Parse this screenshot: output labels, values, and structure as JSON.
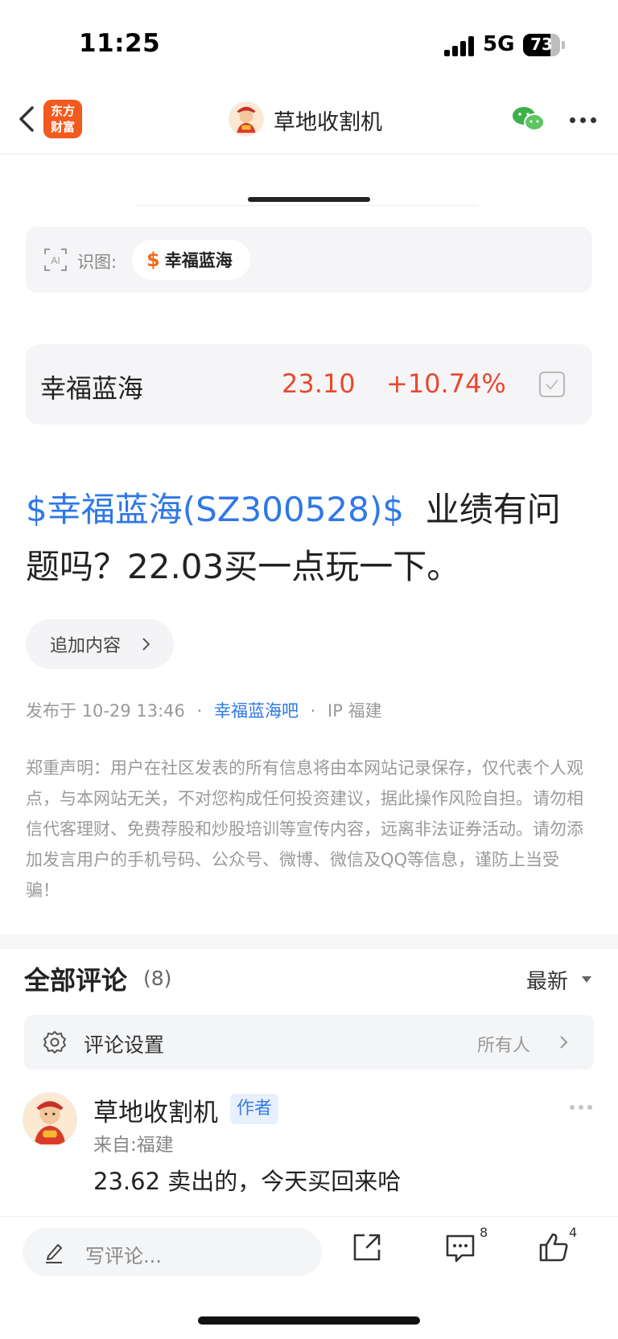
{
  "status_bar": {
    "time": "11:25",
    "network": "5G",
    "battery": "73",
    "battery_level_pct": 73
  },
  "nav": {
    "title": "草地收割机",
    "app_logo_line1": "东方",
    "app_logo_line2": "财富"
  },
  "ai_recognition": {
    "label": "识图:",
    "chip_symbol": "$",
    "chip_name": "幸福蓝海"
  },
  "quote": {
    "name": "幸福蓝海",
    "price": "23.10",
    "change": "+10.74%"
  },
  "post": {
    "stock_link": "$幸福蓝海(SZ300528)$",
    "text_part1": "业绩有问",
    "text_part2": "题吗？22.03买一点玩一下。",
    "add_content_label": "追加内容",
    "published_prefix": "发布于",
    "published_time": "10-29 13:46",
    "bar_name": "幸福蓝海吧",
    "ip_label": "IP 福建",
    "separator": "·"
  },
  "disclaimer": "郑重声明：用户在社区发表的所有信息将由本网站记录保存，仅代表个人观点，与本网站无关，不对您构成任何投资建议，据此操作风险自担。请勿相信代客理财、免费荐股和炒股培训等宣传内容，远离非法证券活动。请勿添加发言用户的手机号码、公众号、微博、微信及QQ等信息，谨防上当受骗！",
  "comments": {
    "title": "全部评论",
    "count": "(8)",
    "sort": "最新",
    "settings_label": "评论设置",
    "settings_value": "所有人",
    "items": [
      {
        "author": "草地收割机",
        "badge": "作者",
        "location": "来自:福建",
        "text": "23.62 卖出的，今天买回来哈"
      }
    ]
  },
  "toolbar": {
    "write_placeholder": "写评论...",
    "comment_count": "8",
    "like_count": "4"
  },
  "colors": {
    "accent_blue": "#2f78e6",
    "rise_red": "#e8482f",
    "brand_orange": "#f25a1e"
  }
}
